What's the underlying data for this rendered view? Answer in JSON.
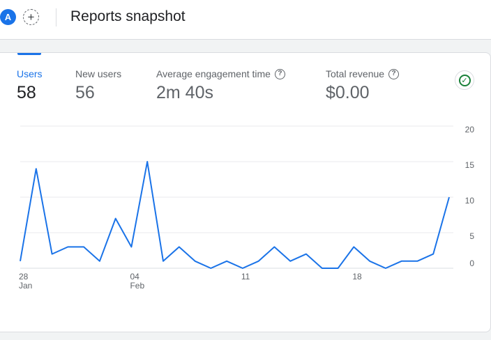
{
  "header": {
    "avatar_letter": "A",
    "add_symbol": "+",
    "title": "Reports snapshot"
  },
  "metrics": [
    {
      "label": "Users",
      "value": "58",
      "active": true,
      "help": false
    },
    {
      "label": "New users",
      "value": "56",
      "active": false,
      "help": false
    },
    {
      "label": "Average engagement time",
      "value": "2m 40s",
      "active": false,
      "help": true
    },
    {
      "label": "Total revenue",
      "value": "$0.00",
      "active": false,
      "help": true
    }
  ],
  "help_symbol": "?",
  "check_symbol": "✓",
  "colors": {
    "accent": "#1a73e8",
    "check": "#188038",
    "grid": "#e8eaed"
  },
  "chart_data": {
    "type": "line",
    "series": [
      {
        "values": [
          1,
          14,
          2,
          3,
          3,
          1,
          7,
          3,
          15,
          1,
          3,
          1,
          0,
          1,
          0,
          1,
          3,
          1,
          2,
          0,
          0,
          3,
          1,
          0,
          1,
          1,
          2,
          10
        ]
      }
    ],
    "x_tick_labels": [
      {
        "index": 0,
        "day": "28",
        "month": "Jan"
      },
      {
        "index": 7,
        "day": "04",
        "month": "Feb"
      },
      {
        "index": 14,
        "day": "11",
        "month": ""
      },
      {
        "index": 21,
        "day": "18",
        "month": ""
      }
    ],
    "y_ticks": [
      0,
      5,
      10,
      15,
      20
    ],
    "ylim": [
      0,
      20
    ],
    "grid": true
  }
}
